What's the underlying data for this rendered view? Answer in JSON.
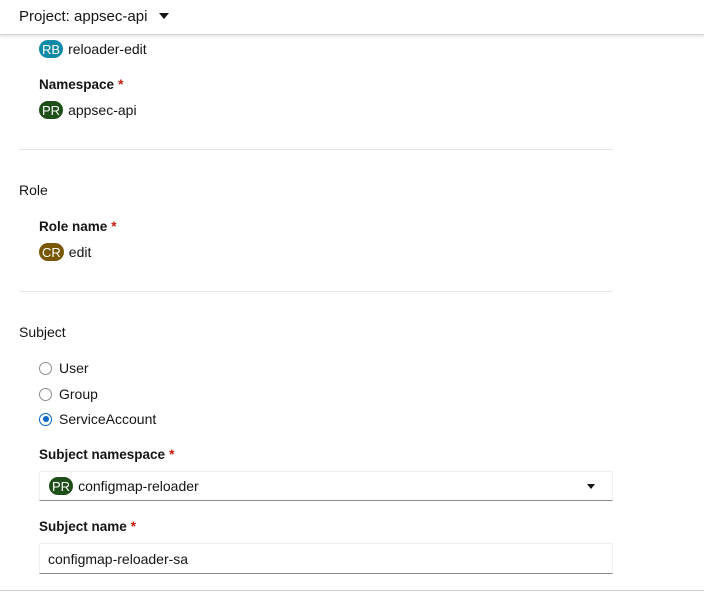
{
  "topbar": {
    "project_label": "Project: appsec-api"
  },
  "binding": {
    "badge": "RB",
    "name": "reloader-edit"
  },
  "namespace": {
    "label": "Namespace",
    "required": "*",
    "badge": "PR",
    "value": "appsec-api"
  },
  "role": {
    "section_title": "Role",
    "name_label": "Role name",
    "required": "*",
    "badge": "CR",
    "value": "edit"
  },
  "subject": {
    "section_title": "Subject",
    "options": [
      {
        "label": "User",
        "checked": false
      },
      {
        "label": "Group",
        "checked": false
      },
      {
        "label": "ServiceAccount",
        "checked": true
      }
    ],
    "namespace_label": "Subject namespace",
    "namespace_required": "*",
    "namespace_badge": "PR",
    "namespace_value": "configmap-reloader",
    "name_label": "Subject name",
    "name_required": "*",
    "name_value": "configmap-reloader-sa"
  },
  "colors": {
    "rb_badge": "#0e8aa6",
    "pr_badge": "#1e4f18",
    "cr_badge": "#795600",
    "required": "#c9190b",
    "radio_selected": "#0066cc"
  }
}
